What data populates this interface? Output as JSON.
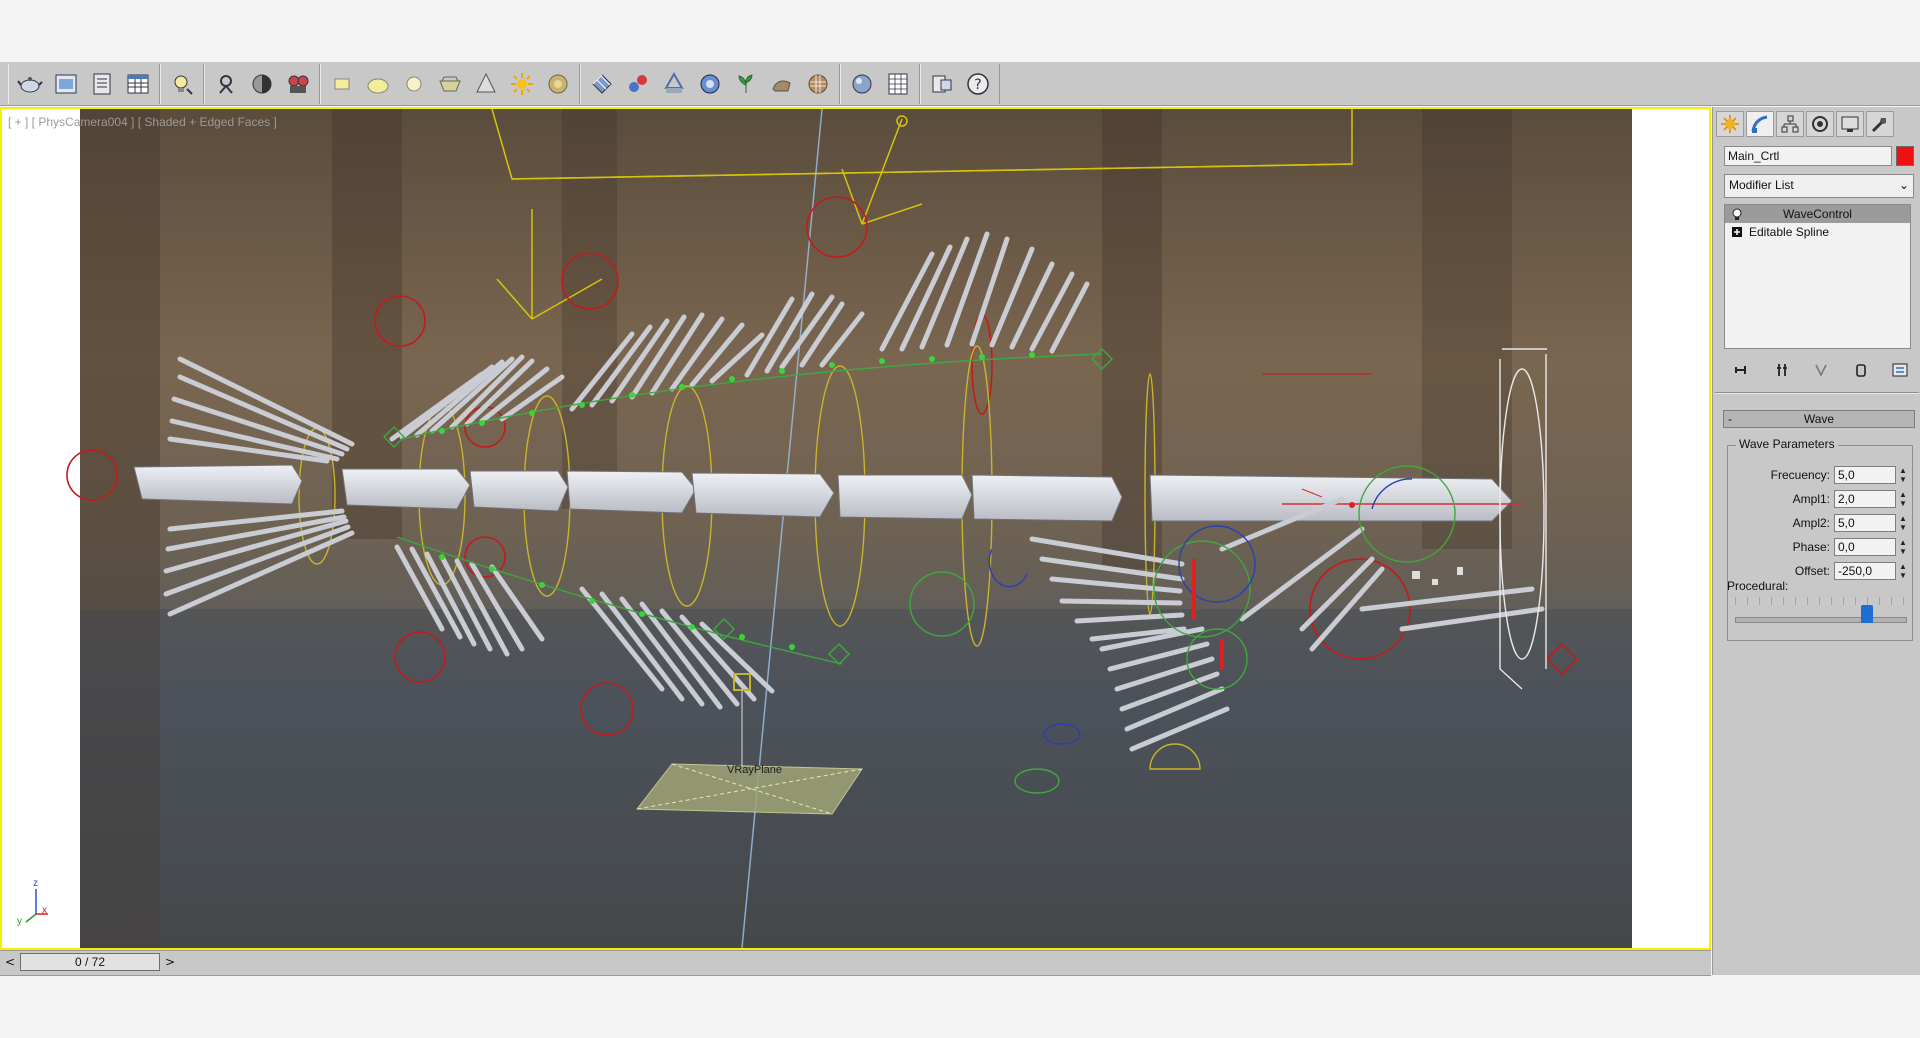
{
  "toolbar": {
    "icons": [
      "teapot-icon",
      "render-frame-icon",
      "render-setup-icon",
      "table-icon",
      "bulb-icon",
      "particle-icon",
      "sphere-checker-icon",
      "camera-reel-icon",
      "plane-icon",
      "ellipse-icon",
      "circle-icon",
      "teapot-bowl-icon",
      "cone-icon",
      "sun-icon",
      "disc-icon",
      "grid-pattern-icon",
      "molecule-icon",
      "geometry-icon",
      "gear-sphere-icon",
      "plant-icon",
      "animal-icon",
      "sphere-pattern-icon",
      "sphere-icon",
      "grid-icon",
      "frame-icon",
      "help-icon"
    ]
  },
  "viewport": {
    "label": "[ + ] [ PhysCamera004 ] [ Shaded + Edged Faces ]",
    "plane_label": "VRayPlane",
    "frame_color": "#f4f000",
    "axis": {
      "z": "z",
      "y": "y",
      "x": "x"
    }
  },
  "command_panel": {
    "object_name": "Main_Crtl",
    "object_color": "#ee1111",
    "modifier_list": "Modifier List",
    "stack": [
      {
        "label": "WaveControl",
        "selected": true
      },
      {
        "label": "Editable Spline",
        "selected": false
      }
    ],
    "rollout": "Wave",
    "rollout_collapse": "-",
    "group_title": "Wave Parameters",
    "params": [
      {
        "label": "Frecuency:",
        "value": "5,0"
      },
      {
        "label": "Ampl1:",
        "value": "2,0"
      },
      {
        "label": "Ampl2:",
        "value": "5,0"
      },
      {
        "label": "Phase:",
        "value": "0,0"
      },
      {
        "label": "Offset:",
        "value": "-250,0"
      }
    ],
    "procedural_label": "Procedural:"
  },
  "timeline": {
    "frame_display": "0 / 72",
    "prev": "<",
    "next": ">"
  }
}
